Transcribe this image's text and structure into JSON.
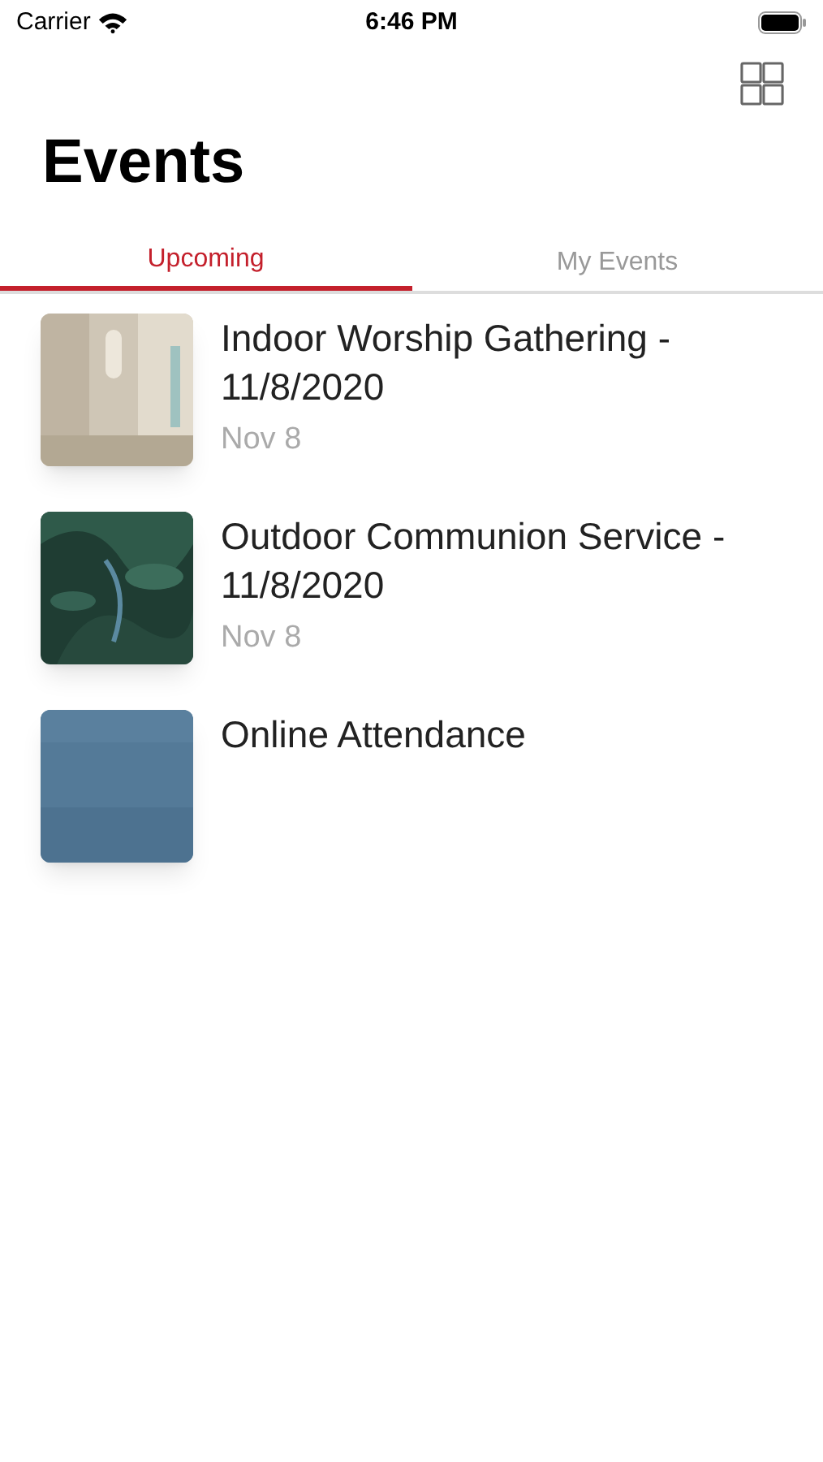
{
  "status_bar": {
    "carrier": "Carrier",
    "time": "6:46 PM"
  },
  "title": "Events",
  "tabs": [
    {
      "label": "Upcoming",
      "selected": true
    },
    {
      "label": "My Events",
      "selected": false
    }
  ],
  "events": [
    {
      "title": "Indoor Worship Gathering - 11/8/2020",
      "date": "Nov 8"
    },
    {
      "title": "Outdoor Communion Service  - 11/8/2020",
      "date": "Nov 8"
    },
    {
      "title": "Online Attendance"
    }
  ]
}
